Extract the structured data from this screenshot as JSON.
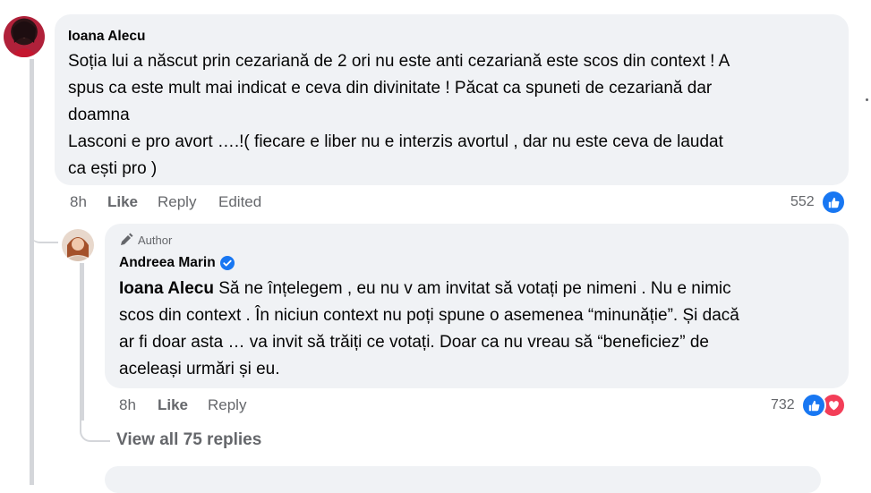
{
  "comment1": {
    "author": "Ioana Alecu",
    "lines": [
      "Soția lui a născut prin cezariană de 2 ori nu este anti cezariană este scos din context ! A",
      "spus ca este mult mai indicat e ceva din divinitate ! Păcat ca spuneti de cezariană dar",
      "doamna",
      "Lasconi e pro avort ….!( fiecare e liber nu e interzis avortul , dar nu este ceva de laudat",
      "ca ești pro )"
    ],
    "time": "8h",
    "like": "Like",
    "reply": "Reply",
    "edited": "Edited",
    "reaction_count": "552"
  },
  "reply1": {
    "badge": "Author",
    "author": "Andreea Marin",
    "mention": "Ioana Alecu",
    "lines": [
      " Să ne înțelegem , eu nu v am invitat să votați pe nimeni . Nu e nimic",
      "scos din context . În niciun context nu poți spune o asemenea “minunăție”. Și dacă",
      "ar fi doar asta … va invit să trăiți ce votați. Doar ca nu vreau să “beneficiez” de",
      "aceleași urmări și eu."
    ],
    "time": "8h",
    "like": "Like",
    "reply": "Reply",
    "reaction_count": "732"
  },
  "view_replies": "View all 75 replies",
  "colors": {
    "like_blue": "#1877f2",
    "love_red": "#f33e58",
    "bubble": "#f0f2f5",
    "meta": "#65676b"
  },
  "icons": [
    "like-icon",
    "love-icon",
    "verified-badge-icon",
    "author-pen-icon"
  ]
}
